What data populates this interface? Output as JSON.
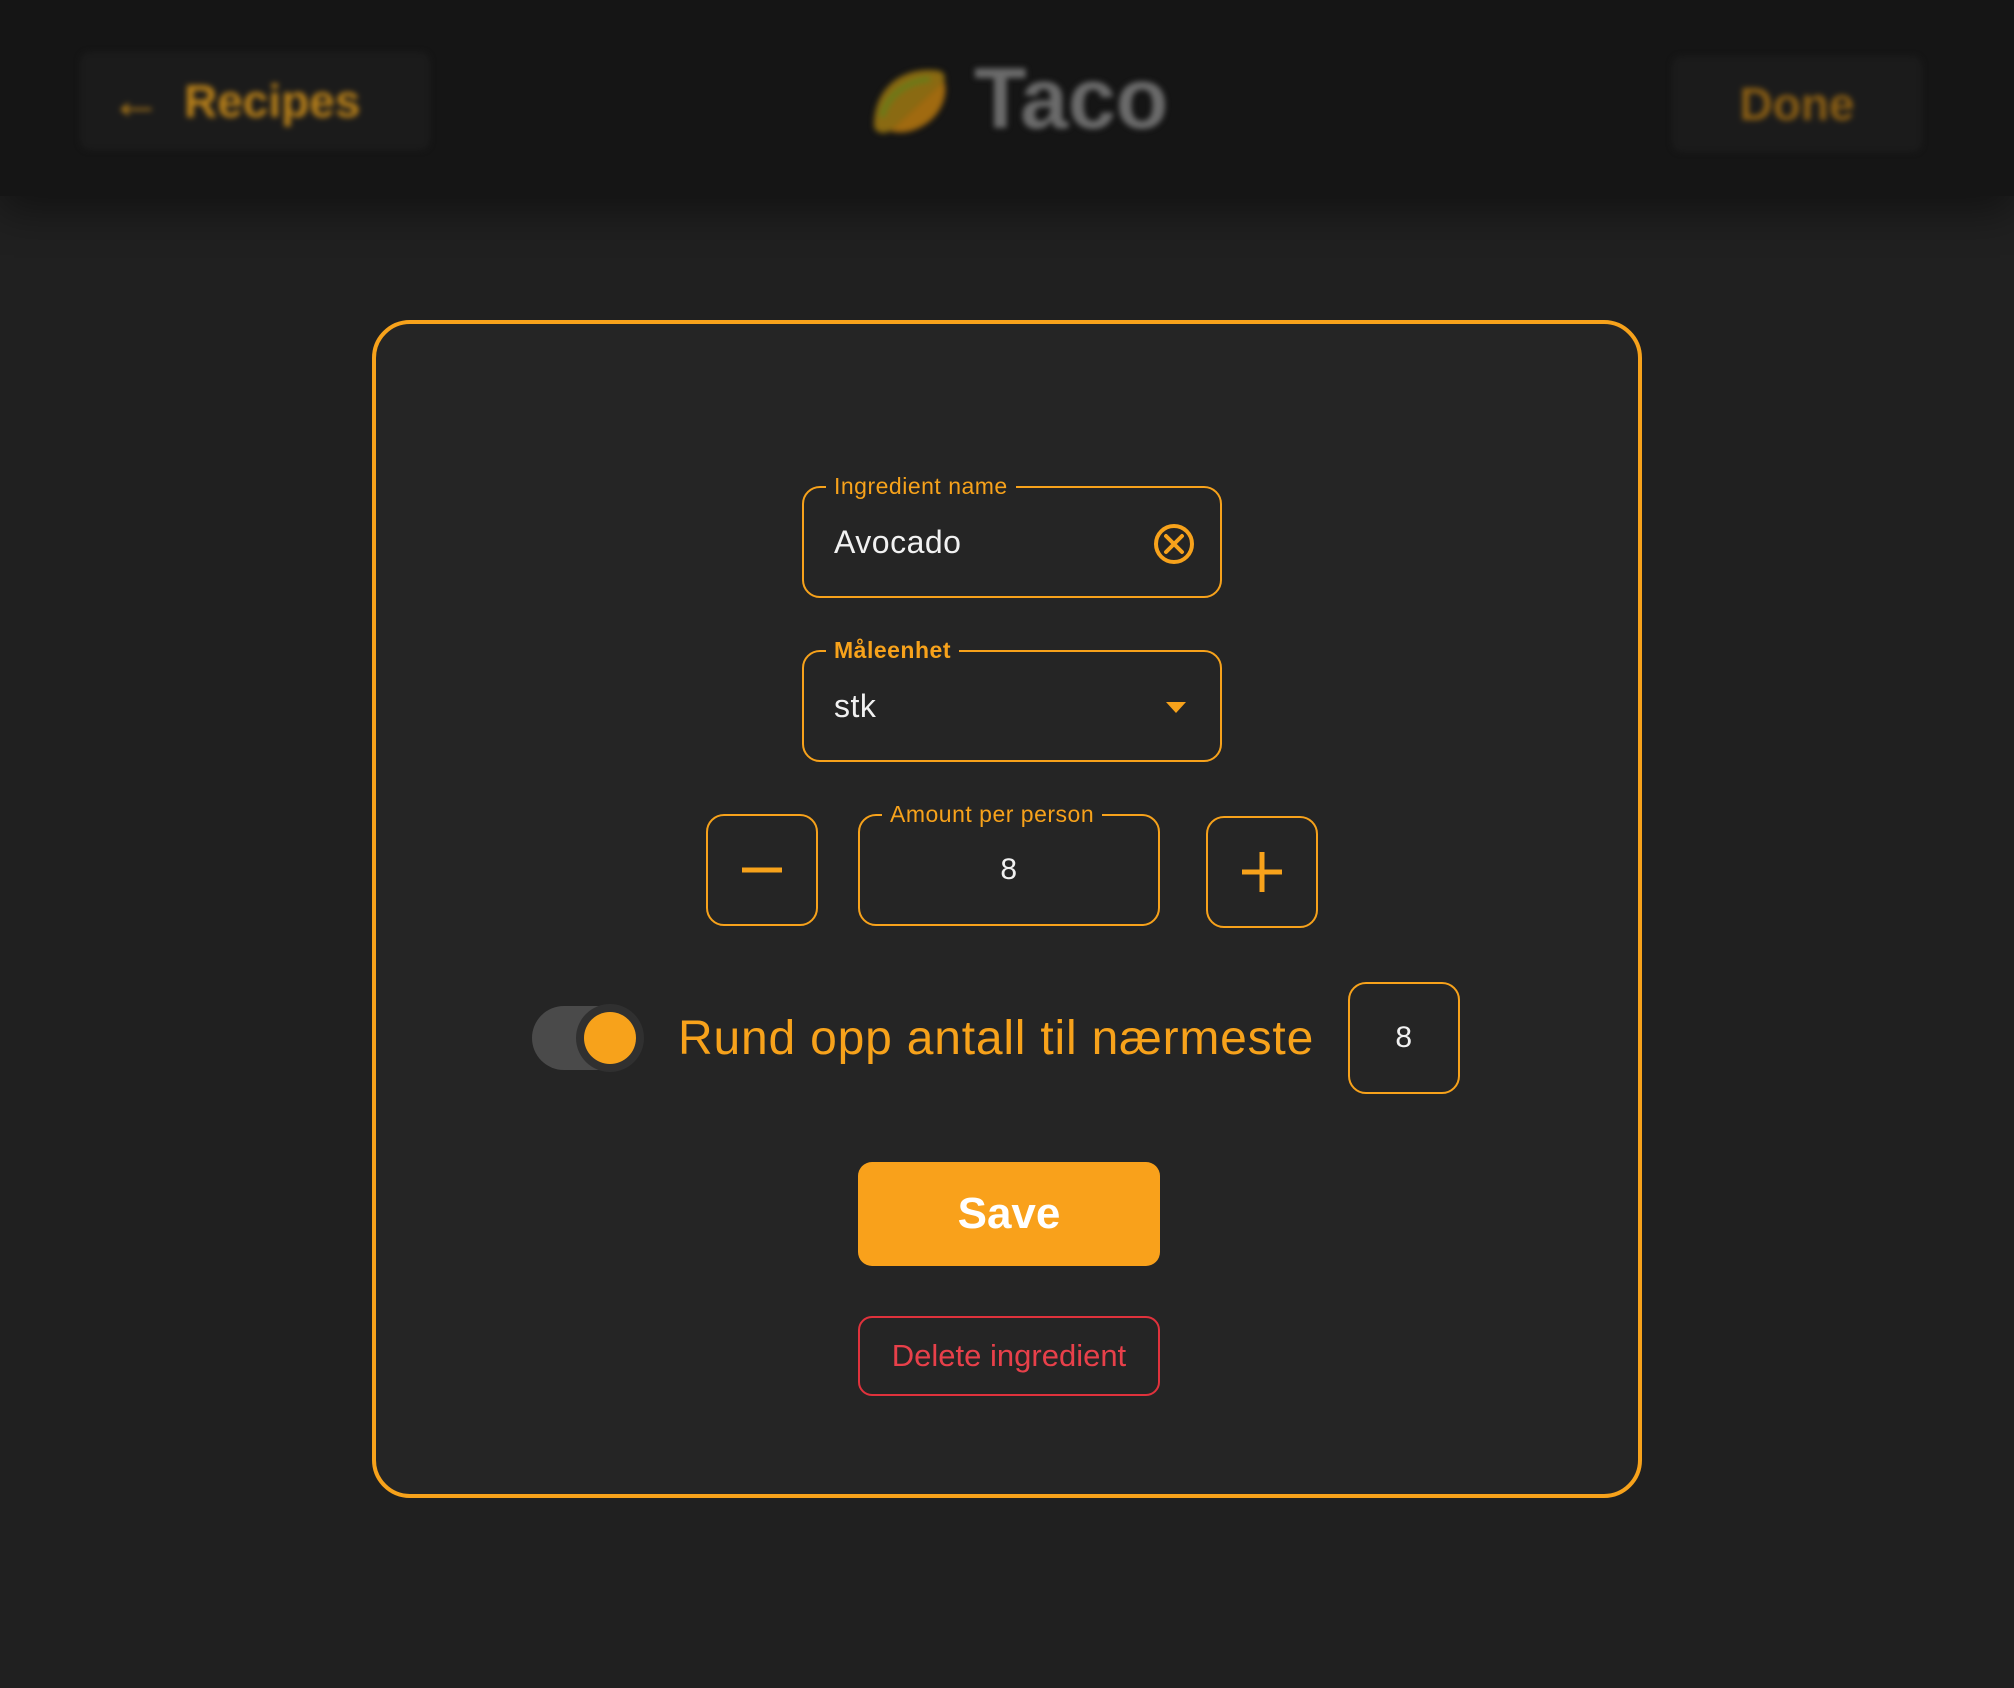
{
  "colors": {
    "accent": "#f7a21b",
    "danger": "#e0323c",
    "background": "#202020",
    "card_background": "#252525"
  },
  "header": {
    "back_label": "Recipes",
    "back_icon": "arrow-left-icon",
    "brand_title": "Taco",
    "brand_icon": "taco-icon",
    "done_label": "Done"
  },
  "form": {
    "ingredient_name": {
      "label": "Ingredient name",
      "value": "Avocado",
      "clear_icon": "close-circle-icon"
    },
    "unit": {
      "label": "Måleenhet",
      "value": "stk",
      "dropdown_icon": "caret-down-icon"
    },
    "amount": {
      "label": "Amount per person",
      "value": "8",
      "decrement_icon": "minus-icon",
      "increment_icon": "plus-icon"
    },
    "round_up": {
      "enabled": true,
      "label": "Rund opp antall til nærmeste",
      "value": "8"
    },
    "save_label": "Save",
    "delete_label": "Delete ingredient"
  }
}
